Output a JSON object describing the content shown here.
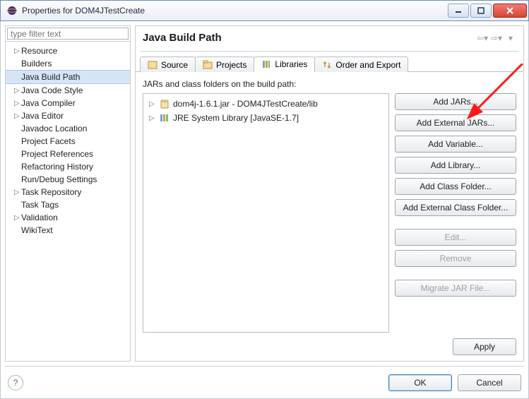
{
  "window": {
    "title": "Properties for DOM4JTestCreate"
  },
  "nav": {
    "items": [
      {
        "label": "Resource",
        "expandable": true
      },
      {
        "label": "Builders"
      },
      {
        "label": "Java Build Path",
        "selected": true
      },
      {
        "label": "Java Code Style",
        "expandable": true
      },
      {
        "label": "Java Compiler",
        "expandable": true
      },
      {
        "label": "Java Editor",
        "expandable": true
      },
      {
        "label": "Javadoc Location"
      },
      {
        "label": "Project Facets"
      },
      {
        "label": "Project References"
      },
      {
        "label": "Refactoring History"
      },
      {
        "label": "Run/Debug Settings"
      },
      {
        "label": "Task Repository",
        "expandable": true
      },
      {
        "label": "Task Tags"
      },
      {
        "label": "Validation",
        "expandable": true
      },
      {
        "label": "WikiText"
      }
    ],
    "filter_placeholder": "type filter text"
  },
  "main": {
    "heading": "Java Build Path",
    "tabs": [
      {
        "label": "Source"
      },
      {
        "label": "Projects"
      },
      {
        "label": "Libraries",
        "active": true
      },
      {
        "label": "Order and Export"
      }
    ],
    "libraries": {
      "caption": "JARs and class folders on the build path:",
      "entries": [
        {
          "label": "dom4j-1.6.1.jar - DOM4JTestCreate/lib",
          "icon": "jar"
        },
        {
          "label": "JRE System Library [JavaSE-1.7]",
          "icon": "jre"
        }
      ]
    },
    "buttons": {
      "add_jars": "Add JARs...",
      "add_external_jars": "Add External JARs...",
      "add_variable": "Add Variable...",
      "add_library": "Add Library...",
      "add_class_folder": "Add Class Folder...",
      "add_external_class_folder": "Add External Class Folder...",
      "edit": "Edit...",
      "remove": "Remove",
      "migrate": "Migrate JAR File...",
      "apply": "Apply"
    }
  },
  "footer": {
    "ok": "OK",
    "cancel": "Cancel"
  }
}
